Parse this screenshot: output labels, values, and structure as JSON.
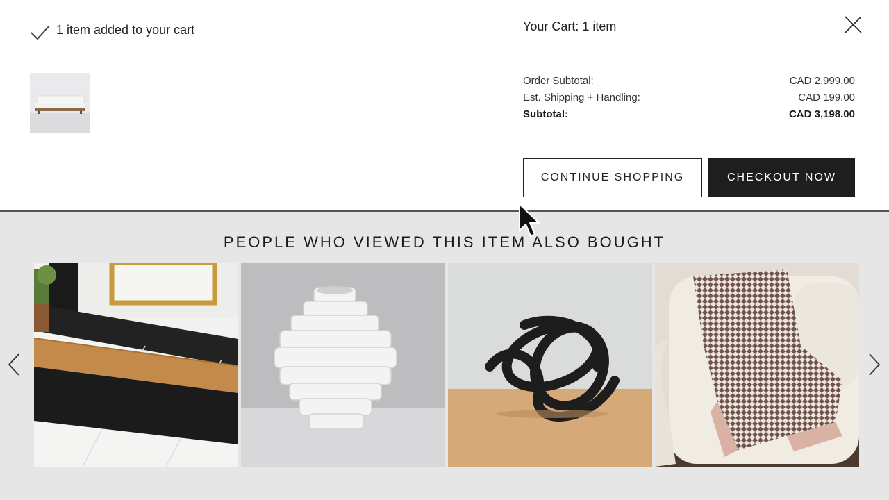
{
  "confirmation": {
    "message": "1 item added to your cart"
  },
  "cart": {
    "title": "Your Cart: 1 item",
    "rows": [
      {
        "label": "Order Subtotal:",
        "value": "CAD 2,999.00"
      },
      {
        "label": "Est. Shipping + Handling:",
        "value": "CAD 199.00"
      },
      {
        "label": "Subtotal:",
        "value": "CAD 3,198.00"
      }
    ],
    "continue_label": "CONTINUE SHOPPING",
    "checkout_label": "CHECKOUT NOW"
  },
  "recommendations": {
    "title": "PEOPLE WHO VIEWED THIS ITEM ALSO BOUGHT",
    "items": [
      {
        "icon": "doormat-image"
      },
      {
        "icon": "white-vase-image"
      },
      {
        "icon": "black-knot-sculpture-image"
      },
      {
        "icon": "knit-throw-blanket-image"
      }
    ]
  },
  "colors": {
    "accent_dark": "#1e1e1e",
    "panel_bg": "#e6e6e6"
  }
}
